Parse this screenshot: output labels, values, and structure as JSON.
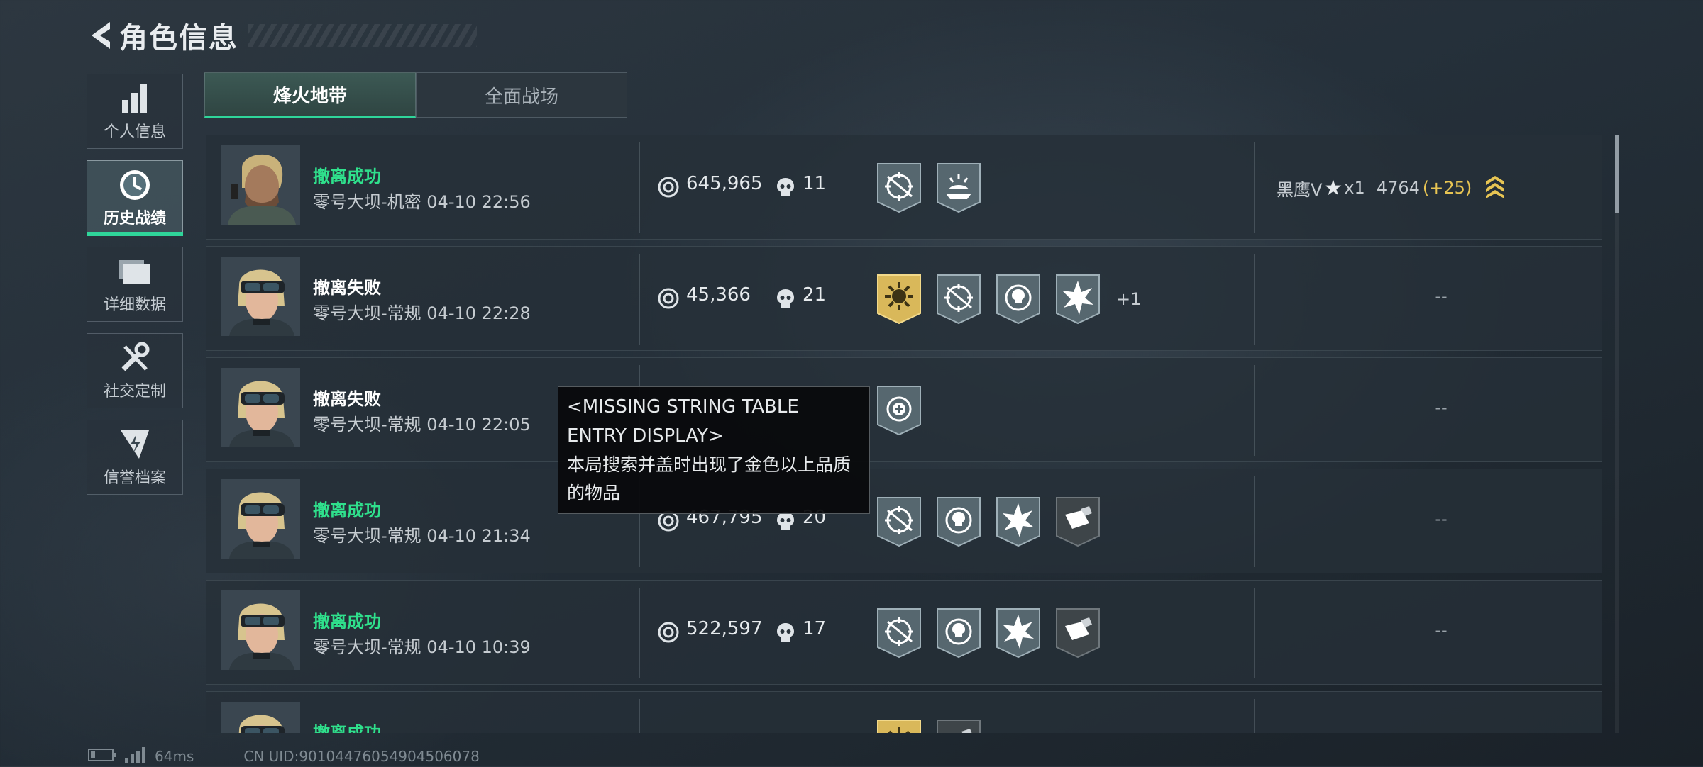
{
  "header": {
    "title": "角色信息",
    "back_icon": "chevron-left-icon"
  },
  "sidebar": {
    "items": [
      {
        "label": "个人信息",
        "icon": "bar-chart-icon",
        "active": false
      },
      {
        "label": "历史战绩",
        "icon": "clock-history-icon",
        "active": true
      },
      {
        "label": "详细数据",
        "icon": "folder-icon",
        "active": false
      },
      {
        "label": "社交定制",
        "icon": "tools-icon",
        "active": false
      },
      {
        "label": "信誉档案",
        "icon": "shield-bolt-icon",
        "active": false
      }
    ]
  },
  "tabs": [
    {
      "label": "烽火地带",
      "active": true
    },
    {
      "label": "全面战场",
      "active": false
    }
  ],
  "records": [
    {
      "status": "撤离成功",
      "result": "success",
      "map": "零号大坝-机密 04-10 22:56",
      "value": "645,965",
      "kills": "11",
      "badges": [
        "target-crosshair-badge",
        "sun-hand-badge"
      ],
      "extra": "",
      "rank": {
        "name": "黑鹰V",
        "star": "★",
        "multiplier": "x1",
        "score": "4764",
        "delta": "(+25)"
      },
      "dash": ""
    },
    {
      "status": "撤离失败",
      "result": "fail",
      "map": "零号大坝-常规 04-10 22:28",
      "value": "45,366",
      "kills": "21",
      "badges": [
        "gold-sun-badge",
        "target-crosshair-badge",
        "skull-crosshair-badge",
        "burst-badge"
      ],
      "extra": "+1",
      "rank": null,
      "dash": "--"
    },
    {
      "status": "撤离失败",
      "result": "fail",
      "map": "零号大坝-常规 04-10 22:05",
      "value": "",
      "kills": "",
      "badges": [
        "medic-crosshair-badge"
      ],
      "extra": "",
      "rank": null,
      "dash": "--"
    },
    {
      "status": "撤离成功",
      "result": "success",
      "map": "零号大坝-常规 04-10 21:34",
      "value": "467,795",
      "kills": "20",
      "badges": [
        "target-crosshair-badge",
        "skull-crosshair-badge",
        "burst-badge",
        "loot-badge"
      ],
      "extra": "",
      "rank": null,
      "dash": "--"
    },
    {
      "status": "撤离成功",
      "result": "success",
      "map": "零号大坝-常规 04-10 10:39",
      "value": "522,597",
      "kills": "17",
      "badges": [
        "target-crosshair-badge",
        "skull-crosshair-badge",
        "burst-badge",
        "loot-badge"
      ],
      "extra": "",
      "rank": null,
      "dash": "--"
    },
    {
      "status": "撤离成功",
      "result": "success",
      "map": "",
      "value": "",
      "kills": "",
      "badges": [
        "gold-sun-badge",
        "loot-badge"
      ],
      "extra": "",
      "rank": null,
      "dash": ""
    }
  ],
  "tooltip": {
    "title": "<MISSING STRING TABLE ENTRY DISPLAY>",
    "body": "本局搜索并盖时出现了金色以上品质的物品"
  },
  "footer": {
    "ping": "64ms",
    "uid": "CN UID:90104476054904506078"
  },
  "colors": {
    "accent": "#2fd59a",
    "success": "#2fe08c",
    "gold": "#e8c553"
  }
}
